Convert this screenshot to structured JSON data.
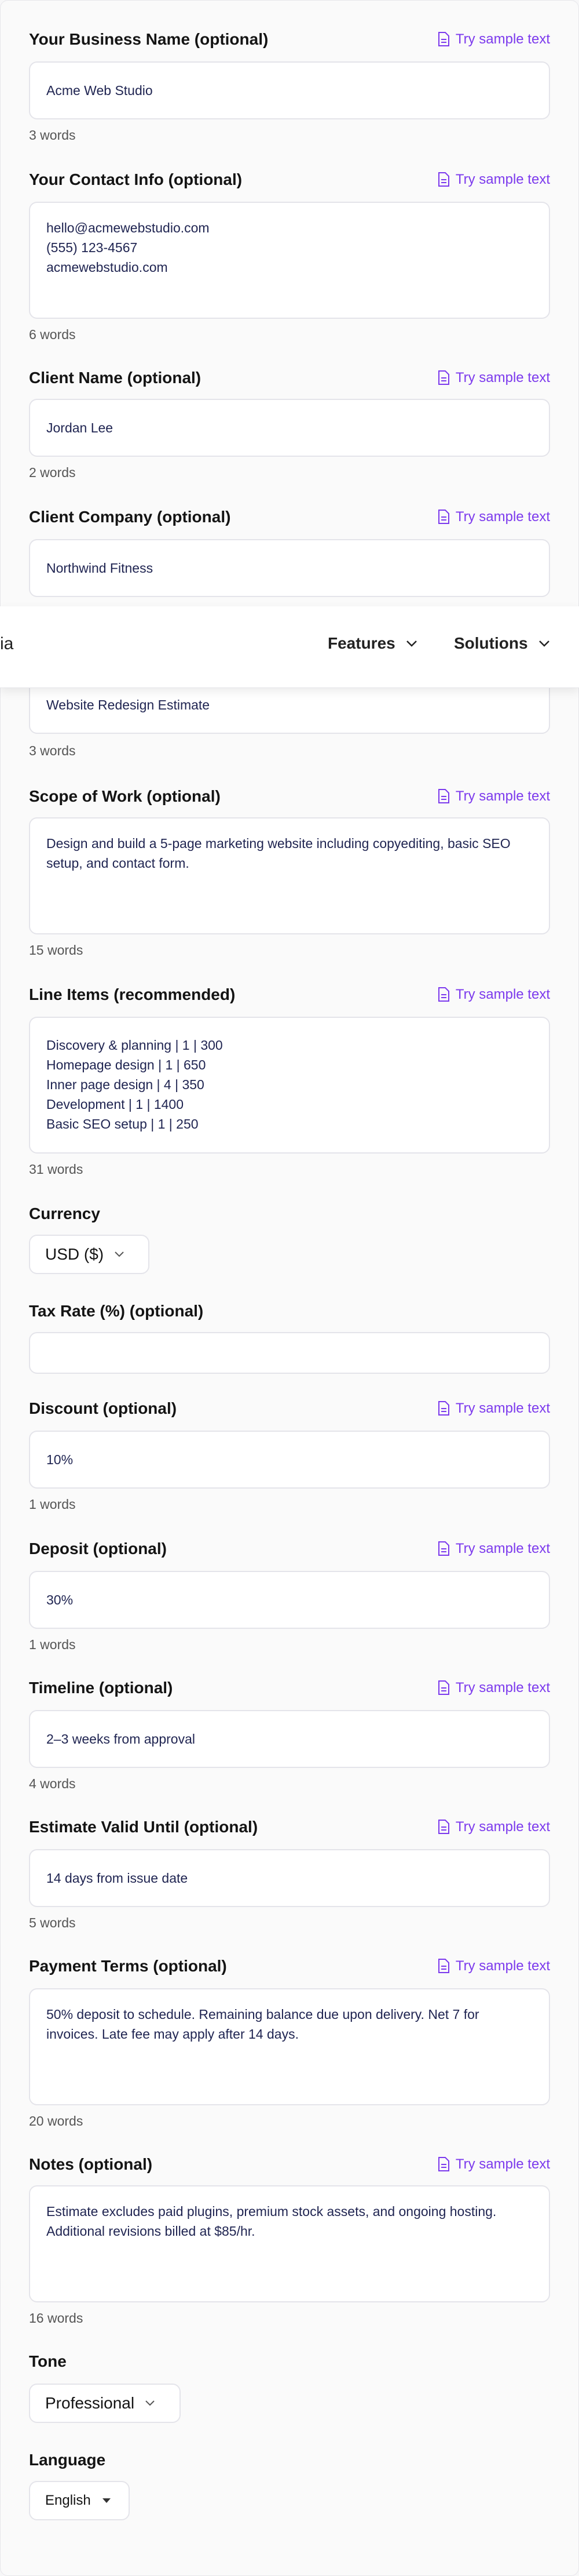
{
  "sample_link": "Try sample text",
  "fields": {
    "business_name": {
      "label": "Your Business Name (optional)",
      "value": "Acme Web Studio",
      "count": "3 words"
    },
    "contact_info": {
      "label": "Your Contact Info (optional)",
      "value": "hello@acmewebstudio.com\n(555) 123-4567\nacmewebstudio.com",
      "count": "6 words"
    },
    "client_name": {
      "label": "Client Name (optional)",
      "value": "Jordan Lee",
      "count": "2 words"
    },
    "client_company": {
      "label": "Client Company (optional)",
      "value": "Northwind Fitness"
    },
    "project_title": {
      "value": "Website Redesign Estimate",
      "count": "3 words"
    },
    "scope": {
      "label": "Scope of Work (optional)",
      "value": "Design and build a 5-page marketing website including copyediting, basic SEO setup, and contact form.",
      "count": "15 words"
    },
    "line_items": {
      "label": "Line Items (recommended)",
      "value": "Discovery & planning | 1 | 300\nHomepage design | 1 | 650\nInner page design | 4 | 350\nDevelopment | 1 | 1400\nBasic SEO setup | 1 | 250",
      "count": "31 words"
    },
    "currency": {
      "label": "Currency",
      "value": "USD ($)"
    },
    "tax_rate": {
      "label": "Tax Rate (%) (optional)",
      "value": ""
    },
    "discount": {
      "label": "Discount (optional)",
      "value": "10%",
      "count": "1 words"
    },
    "deposit": {
      "label": "Deposit (optional)",
      "value": "30%",
      "count": "1 words"
    },
    "timeline": {
      "label": "Timeline (optional)",
      "value": "2–3 weeks from approval",
      "count": "4 words"
    },
    "valid_until": {
      "label": "Estimate Valid Until (optional)",
      "value": "14 days from issue date",
      "count": "5 words"
    },
    "payment_terms": {
      "label": "Payment Terms (optional)",
      "value": "50% deposit to schedule. Remaining balance due upon delivery. Net 7 for invoices. Late fee may apply after 14 days.",
      "count": "20 words"
    },
    "notes": {
      "label": "Notes (optional)",
      "value": "Estimate excludes paid plugins, premium stock assets, and ongoing hosting. Additional revisions billed at $85/hr.",
      "count": "16 words"
    },
    "tone": {
      "label": "Tone",
      "value": "Professional"
    },
    "language": {
      "label": "Language",
      "value": "English"
    }
  },
  "navbar": {
    "logo_fragment": "ia",
    "features": "Features",
    "solutions": "Solutions"
  },
  "accent_color": "#7c3aed"
}
